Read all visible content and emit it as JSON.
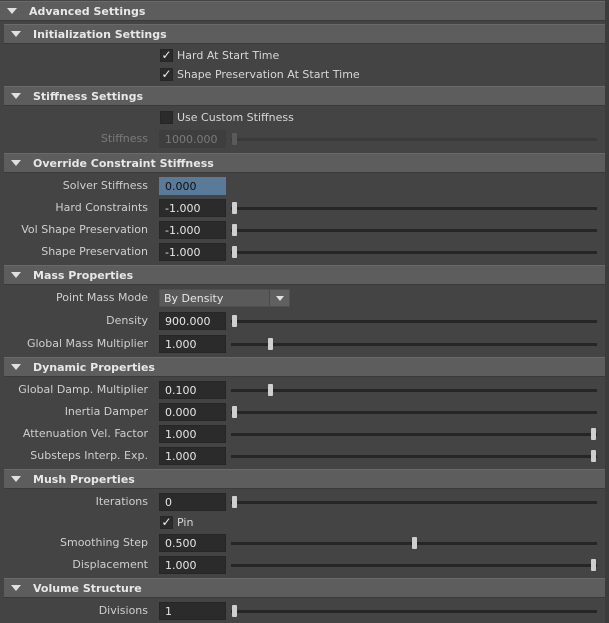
{
  "sections": {
    "advanced": {
      "title": "Advanced Settings"
    },
    "initialization": {
      "title": "Initialization Settings",
      "hard_at_start": {
        "label": "Hard At Start Time",
        "checked": true
      },
      "shape_pres_at_start": {
        "label": "Shape Preservation At Start Time",
        "checked": true
      }
    },
    "stiffness": {
      "title": "Stiffness Settings",
      "use_custom": {
        "label": "Use Custom Stiffness",
        "checked": false
      },
      "stiffness": {
        "label": "Stiffness",
        "value": "1000.000",
        "slider": 0.0,
        "enabled": false
      }
    },
    "override": {
      "title": "Override Constraint Stiffness",
      "solver_stiffness": {
        "label": "Solver Stiffness",
        "value": "0.000"
      },
      "hard_constraints": {
        "label": "Hard Constraints",
        "value": "-1.000",
        "slider": 0.0
      },
      "vol_shape": {
        "label": "Vol Shape Preservation",
        "value": "-1.000",
        "slider": 0.0
      },
      "shape_pres": {
        "label": "Shape Preservation",
        "value": "-1.000",
        "slider": 0.0
      }
    },
    "mass": {
      "title": "Mass Properties",
      "point_mass_mode": {
        "label": "Point Mass Mode",
        "value": "By Density"
      },
      "density": {
        "label": "Density",
        "value": "900.000",
        "slider": 0.0
      },
      "global_mass": {
        "label": "Global Mass Multiplier",
        "value": "1.000",
        "slider": 0.1
      }
    },
    "dynamic": {
      "title": "Dynamic Properties",
      "global_damp": {
        "label": "Global Damp. Multiplier",
        "value": "0.100",
        "slider": 0.1
      },
      "inertia": {
        "label": "Inertia Damper",
        "value": "0.000",
        "slider": 0.0
      },
      "atten": {
        "label": "Attenuation Vel. Factor",
        "value": "1.000",
        "slider": 1.0
      },
      "substeps": {
        "label": "Substeps Interp. Exp.",
        "value": "1.000",
        "slider": 1.0
      }
    },
    "mush": {
      "title": "Mush Properties",
      "iterations": {
        "label": "Iterations",
        "value": "0",
        "slider": 0.0
      },
      "pin": {
        "label": "Pin",
        "checked": true
      },
      "smoothing": {
        "label": "Smoothing Step",
        "value": "0.500",
        "slider": 0.5
      },
      "displacement": {
        "label": "Displacement",
        "value": "1.000",
        "slider": 1.0
      }
    },
    "volume": {
      "title": "Volume Structure",
      "divisions": {
        "label": "Divisions",
        "value": "1",
        "slider": 0.0
      }
    }
  },
  "icons": {
    "expanded": "triangle-down-icon",
    "check": "checkmark-icon",
    "dropdown": "chevron-down-icon"
  }
}
